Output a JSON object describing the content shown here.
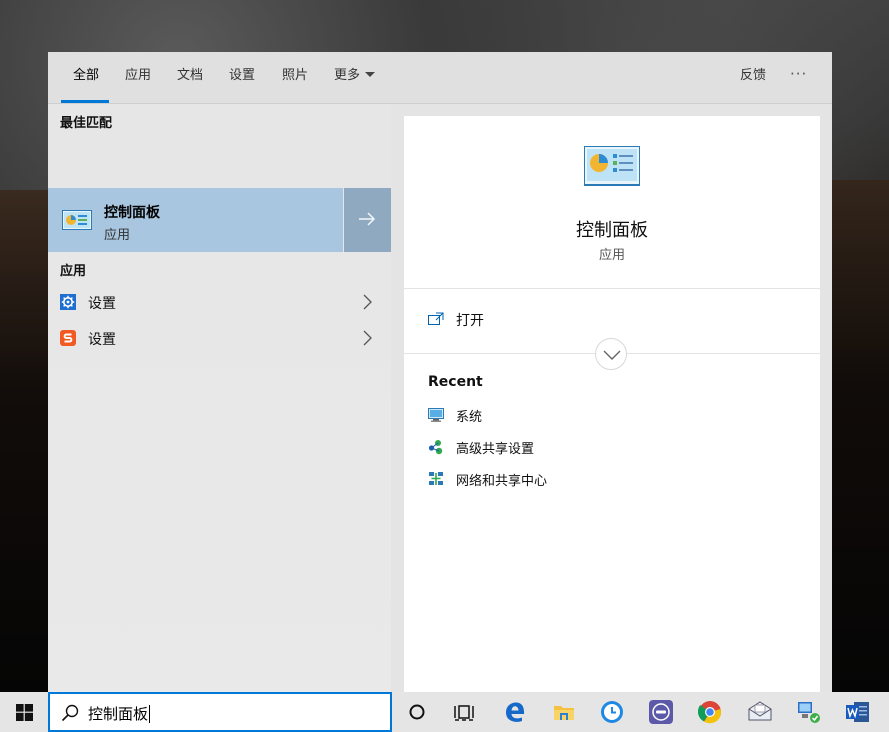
{
  "tabs": [
    {
      "label": "全部",
      "active": true
    },
    {
      "label": "应用"
    },
    {
      "label": "文档"
    },
    {
      "label": "设置"
    },
    {
      "label": "照片"
    },
    {
      "label": "更多"
    }
  ],
  "header_right": {
    "feedback": "反馈",
    "more": "···"
  },
  "left": {
    "best_match_heading": "最佳匹配",
    "best_match": {
      "title": "控制面板",
      "subtitle": "应用",
      "icon": "control-panel-icon"
    },
    "apps_heading": "应用",
    "apps": [
      {
        "label": "设置",
        "icon": "gear-icon"
      },
      {
        "label": "设置",
        "icon": "sogou-s-icon"
      }
    ]
  },
  "detail": {
    "title": "控制面板",
    "subtitle": "应用",
    "open_label": "打开",
    "recent_heading": "Recent",
    "recent": [
      {
        "label": "系统",
        "icon": "system-monitor-icon"
      },
      {
        "label": "高级共享设置",
        "icon": "sharing-icon"
      },
      {
        "label": "网络和共享中心",
        "icon": "network-icon"
      }
    ]
  },
  "taskbar": {
    "search_query": "控制面板",
    "pinned": [
      "cortana-icon",
      "task-view-icon",
      "edge-icon",
      "file-explorer-icon",
      "clock-app-icon",
      "app-badge-icon",
      "chrome-icon",
      "mail-app-icon",
      "remote-desktop-icon",
      "word-icon"
    ]
  },
  "colors": {
    "accent": "#0078d7",
    "selection": "#a8c6e0",
    "selection_arrow": "#8fa9c1"
  }
}
